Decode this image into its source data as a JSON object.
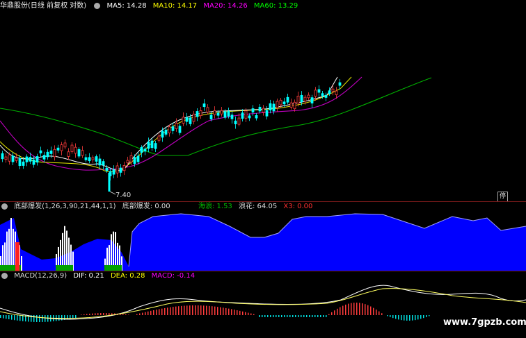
{
  "header": {
    "stock": "华鼎股份(日线 前复权 对数)",
    "ma5": "MA5: 14.28",
    "ma10": "MA10: 14.17",
    "ma20": "MA20: 14.26",
    "ma60": "MA60: 13.29"
  },
  "price_panel": {
    "low_label": "7.40",
    "pin": "停"
  },
  "indicator": {
    "title": "底部爆发(1,26,3,90,21,44,1,1)",
    "value": "底部爆发: 0.00",
    "hailang": "海浪: 1.53",
    "langhua": "浪花: 64.05",
    "x3": "X3: 0.00"
  },
  "macd": {
    "title": "MACD(12,26,9)",
    "dif": "DIF: 0.21",
    "dea": "DEA: 0.28",
    "macd": "MACD: -0.14"
  },
  "watermark": "www.7gpzb.com",
  "colors": {
    "ma5": "#ffffff",
    "ma10": "#ffff00",
    "ma20": "#ff00ff",
    "ma60": "#00ff00",
    "up": "#ff3c3c",
    "down": "#00ffff",
    "sea": "#0000ff",
    "separator": "#7a1b1b"
  }
}
